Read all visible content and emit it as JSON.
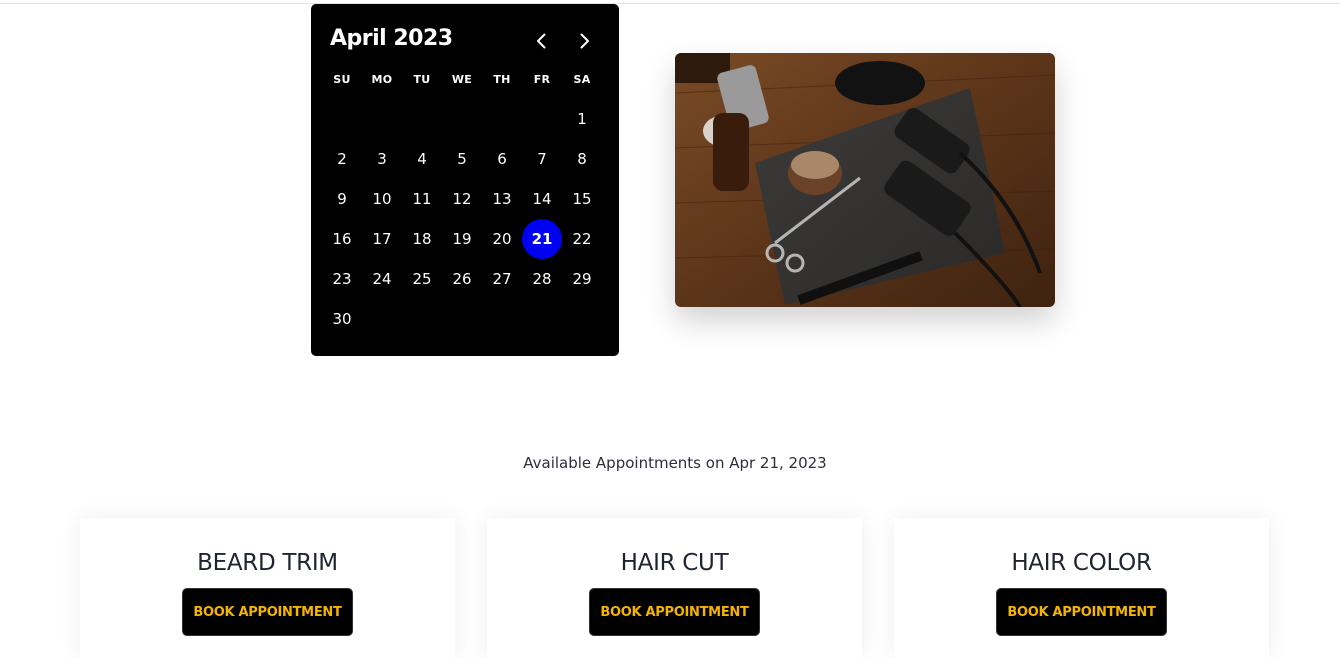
{
  "calendar": {
    "title": "April 2023",
    "weekdays": [
      "SU",
      "MO",
      "TU",
      "WE",
      "TH",
      "FR",
      "SA"
    ],
    "days": [
      "",
      "",
      "",
      "",
      "",
      "",
      "1",
      "2",
      "3",
      "4",
      "5",
      "6",
      "7",
      "8",
      "9",
      "10",
      "11",
      "12",
      "13",
      "14",
      "15",
      "16",
      "17",
      "18",
      "19",
      "20",
      "21",
      "22",
      "23",
      "24",
      "25",
      "26",
      "27",
      "28",
      "29",
      "30"
    ],
    "selected_day": "21",
    "selected_color": "#0000f5",
    "prev_icon": "chevron-left-icon",
    "next_icon": "chevron-right-icon"
  },
  "photo": {
    "subject": "barber-tools-photo"
  },
  "availability": {
    "heading": "Available Appointments on Apr 21, 2023"
  },
  "services": [
    {
      "title": "BEARD TRIM",
      "button": "BOOK APPOINTMENT"
    },
    {
      "title": "HAIR CUT",
      "button": "BOOK APPOINTMENT"
    },
    {
      "title": "HAIR COLOR",
      "button": "BOOK APPOINTMENT"
    }
  ],
  "colors": {
    "button_text": "#f5b400",
    "button_bg": "#000000",
    "calendar_bg": "#000000"
  }
}
